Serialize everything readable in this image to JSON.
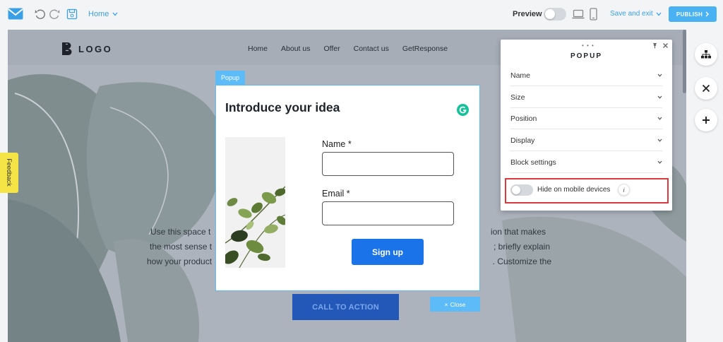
{
  "toolbar": {
    "page_name": "Home",
    "preview_label": "Preview",
    "save_exit_label": "Save and exit",
    "publish_label": "PUBLISH"
  },
  "site": {
    "logo_text": "LOGO",
    "menu": [
      "Home",
      "About us",
      "Offer",
      "Contact us",
      "GetResponse"
    ],
    "body_lines": [
      "Use this space t",
      "ion that makes",
      "the most sense t",
      "; briefly explain",
      "how your product",
      ". Customize the"
    ],
    "cta_label": "CALL TO ACTION",
    "close_label": "Close"
  },
  "popup": {
    "tag": "Popup",
    "title": "Introduce your idea",
    "name_label": "Name *",
    "name_value": "",
    "email_label": "Email *",
    "email_value": "",
    "signup_label": "Sign up"
  },
  "panel": {
    "title": "POPUP",
    "sections": [
      "Name",
      "Size",
      "Position",
      "Display",
      "Block settings"
    ],
    "hide_mobile_label": "Hide on mobile devices",
    "hide_mobile_on": false,
    "info_glyph": "i"
  },
  "feedback_label": "Feedback",
  "colors": {
    "accent": "#49b2f2",
    "signup": "#1a73e8",
    "highlight": "#d9393f",
    "feedback": "#f5e445"
  },
  "icons": [
    "mail-icon",
    "undo-icon",
    "redo-icon",
    "save-icon",
    "desktop-icon",
    "mobile-icon",
    "sitemap-icon",
    "close-icon",
    "plus-icon",
    "grammarly-icon",
    "pin-icon",
    "info-icon"
  ]
}
